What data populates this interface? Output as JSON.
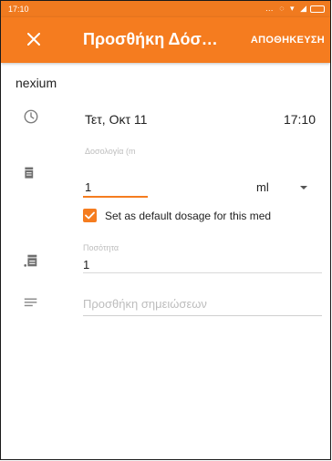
{
  "status_bar": {
    "time": "17:10",
    "icons": "… ◌ ▾ ◢"
  },
  "app_bar": {
    "close_icon": "close-icon",
    "title": "Προσθήκη Δόσ…",
    "save_label": "ΑΠΟΘΗΚΕΥΣΗ"
  },
  "medication": {
    "name": "nexium"
  },
  "datetime": {
    "icon": "clock-icon",
    "date": "Τετ, Οκτ 11",
    "time": "17:10"
  },
  "dosage": {
    "icon": "pill-box-icon",
    "label": "Δοσολογία (m",
    "value": "1",
    "unit": "ml",
    "default_checkbox": {
      "checked": true,
      "label": "Set as default dosage for this med"
    }
  },
  "quantity": {
    "icon": "inventory-icon",
    "label": "Ποσότητα",
    "value": "1"
  },
  "notes": {
    "icon": "notes-icon",
    "placeholder": "Προσθήκη σημειώσεων",
    "value": ""
  },
  "colors": {
    "accent": "#f57c1f",
    "status_bar": "#f07a1f"
  }
}
